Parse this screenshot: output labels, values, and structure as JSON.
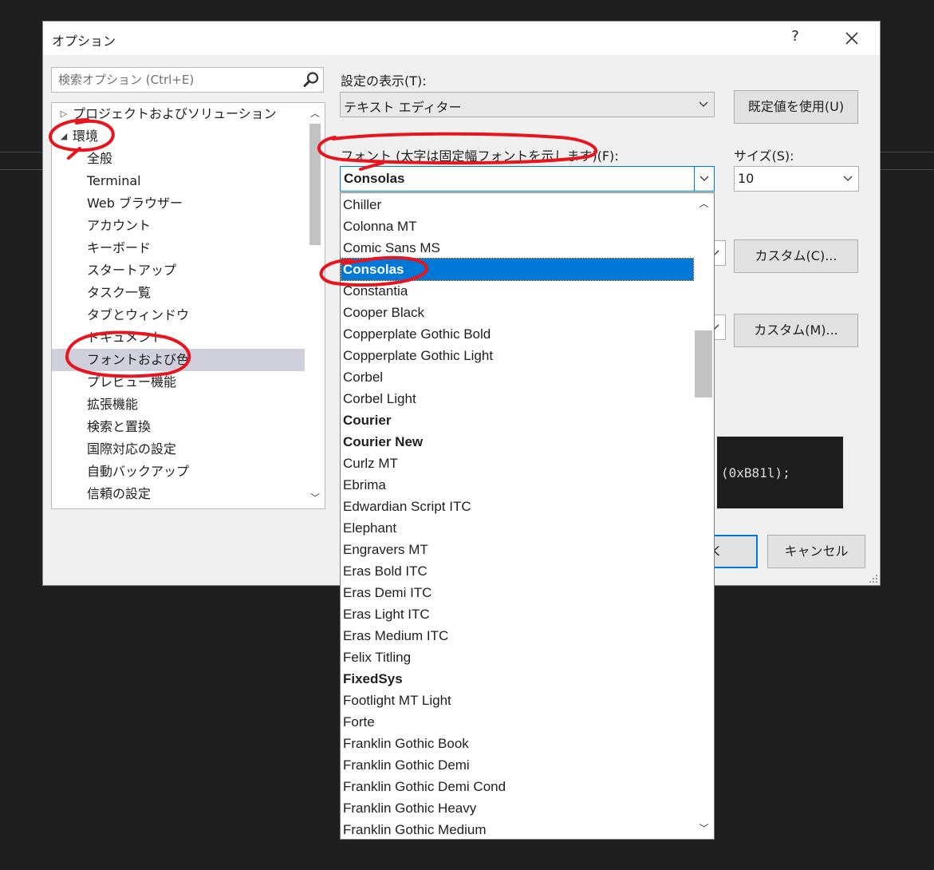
{
  "dialog": {
    "title": "オプション",
    "help": "?",
    "close_icon": "close-icon"
  },
  "search": {
    "placeholder": "検索オプション (Ctrl+E)",
    "icon": "search-icon"
  },
  "tree": {
    "items": [
      {
        "label": "プロジェクトおよびソリューション",
        "arrow": "▷"
      },
      {
        "label": "環境",
        "arrow": "◢"
      },
      {
        "label": "全般"
      },
      {
        "label": "Terminal"
      },
      {
        "label": "Web ブラウザー"
      },
      {
        "label": "アカウント"
      },
      {
        "label": "キーボード"
      },
      {
        "label": "スタートアップ"
      },
      {
        "label": "タスク一覧"
      },
      {
        "label": "タブとウィンドウ"
      },
      {
        "label": "ドキュメント"
      },
      {
        "label": "フォントおよび色",
        "selected": true
      },
      {
        "label": "プレビュー機能"
      },
      {
        "label": "拡張機能"
      },
      {
        "label": "検索と置換"
      },
      {
        "label": "国際対応の設定"
      },
      {
        "label": "自動バックアップ"
      },
      {
        "label": "信頼の設定"
      }
    ]
  },
  "settings": {
    "show_settings_label": "設定の表示(T):",
    "show_settings_value": "テキスト エディター",
    "use_defaults_button": "既定値を使用(U)",
    "font_label": "フォント (太字は固定幅フォントを示します)(F):",
    "font_value": "Consolas",
    "size_label": "サイズ(S):",
    "size_value": "10",
    "custom_c_button": "カスタム(C)...",
    "custom_m_button": "カスタム(M)...",
    "preview_text": "(0xB81l);",
    "ok_button_fragment": "K",
    "cancel_button": "キャンセル"
  },
  "font_list": {
    "items": [
      {
        "label": "Chiller"
      },
      {
        "label": "Colonna MT"
      },
      {
        "label": "Comic Sans MS"
      },
      {
        "label": "Consolas",
        "selected": true
      },
      {
        "label": "Constantia"
      },
      {
        "label": "Cooper Black"
      },
      {
        "label": "Copperplate Gothic Bold"
      },
      {
        "label": "Copperplate Gothic Light"
      },
      {
        "label": "Corbel"
      },
      {
        "label": "Corbel Light"
      },
      {
        "label": "Courier",
        "bold": true
      },
      {
        "label": "Courier New",
        "bold": true
      },
      {
        "label": "Curlz MT"
      },
      {
        "label": "Ebrima"
      },
      {
        "label": "Edwardian Script ITC"
      },
      {
        "label": "Elephant"
      },
      {
        "label": "Engravers MT"
      },
      {
        "label": "Eras Bold ITC"
      },
      {
        "label": "Eras Demi ITC"
      },
      {
        "label": "Eras Light ITC"
      },
      {
        "label": "Eras Medium ITC"
      },
      {
        "label": "Felix Titling"
      },
      {
        "label": "FixedSys",
        "bold": true
      },
      {
        "label": "Footlight MT Light"
      },
      {
        "label": "Forte"
      },
      {
        "label": "Franklin Gothic Book"
      },
      {
        "label": "Franklin Gothic Demi"
      },
      {
        "label": "Franklin Gothic Demi Cond"
      },
      {
        "label": "Franklin Gothic Heavy"
      },
      {
        "label": "Franklin Gothic Medium"
      }
    ]
  },
  "colors": {
    "selection": "#0078d7",
    "tree_selection": "#cfd0dc",
    "annotation": "#e8141e"
  }
}
